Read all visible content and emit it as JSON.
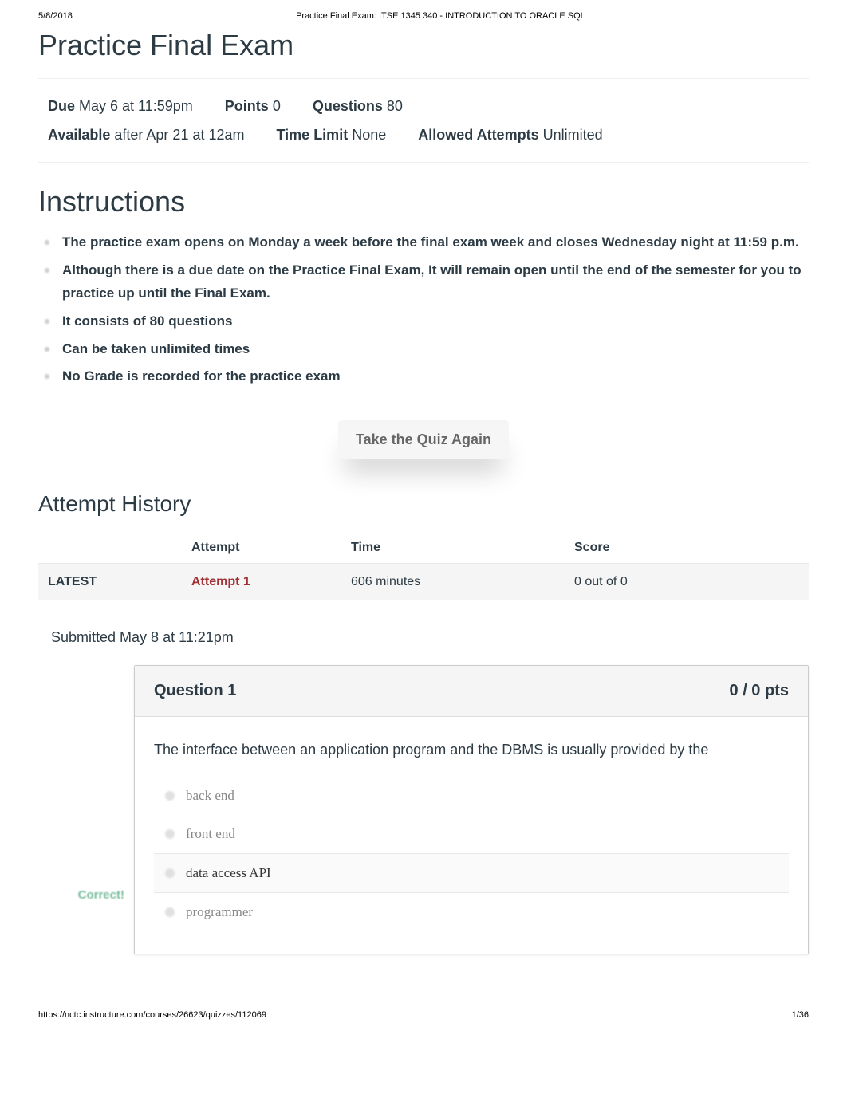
{
  "print_header": {
    "date": "5/8/2018",
    "title": "Practice Final Exam: ITSE 1345 340 - INTRODUCTION TO ORACLE SQL"
  },
  "page_title": "Practice Final Exam",
  "meta": {
    "due_label": "Due",
    "due_value": "May 6 at 11:59pm",
    "points_label": "Points",
    "points_value": "0",
    "questions_label": "Questions",
    "questions_value": "80",
    "available_label": "Available",
    "available_value": "after Apr 21 at 12am",
    "time_limit_label": "Time Limit",
    "time_limit_value": "None",
    "allowed_attempts_label": "Allowed Attempts",
    "allowed_attempts_value": "Unlimited"
  },
  "instructions_title": "Instructions",
  "instructions": [
    "The practice exam opens on Monday a week before the final exam week and closes Wednesday night at 11:59 p.m.",
    "Although there is a due date on the Practice Final Exam, It will remain open until the end of the semester for you to practice up until the Final Exam.",
    "It consists of 80 questions",
    "Can be taken unlimited times",
    "No Grade is recorded for the practice exam"
  ],
  "take_quiz_label": "Take the Quiz Again",
  "attempt_history_title": "Attempt History",
  "history": {
    "headers": {
      "attempt": "Attempt",
      "time": "Time",
      "score": "Score"
    },
    "rows": [
      {
        "status": "LATEST",
        "attempt": "Attempt 1",
        "time": "606 minutes",
        "score": "0 out of 0"
      }
    ]
  },
  "submitted": "Submitted May 8 at 11:21pm",
  "question": {
    "title": "Question 1",
    "points": "0 / 0 pts",
    "text": "The interface between an application program and the DBMS is usually provided by the",
    "correct_label": "Correct!",
    "options": [
      {
        "text": "back end",
        "correct": false
      },
      {
        "text": "front end",
        "correct": false
      },
      {
        "text": "data access API",
        "correct": true
      },
      {
        "text": "programmer",
        "correct": false
      }
    ]
  },
  "footer": {
    "url": "https://nctc.instructure.com/courses/26623/quizzes/112069",
    "page": "1/36"
  }
}
